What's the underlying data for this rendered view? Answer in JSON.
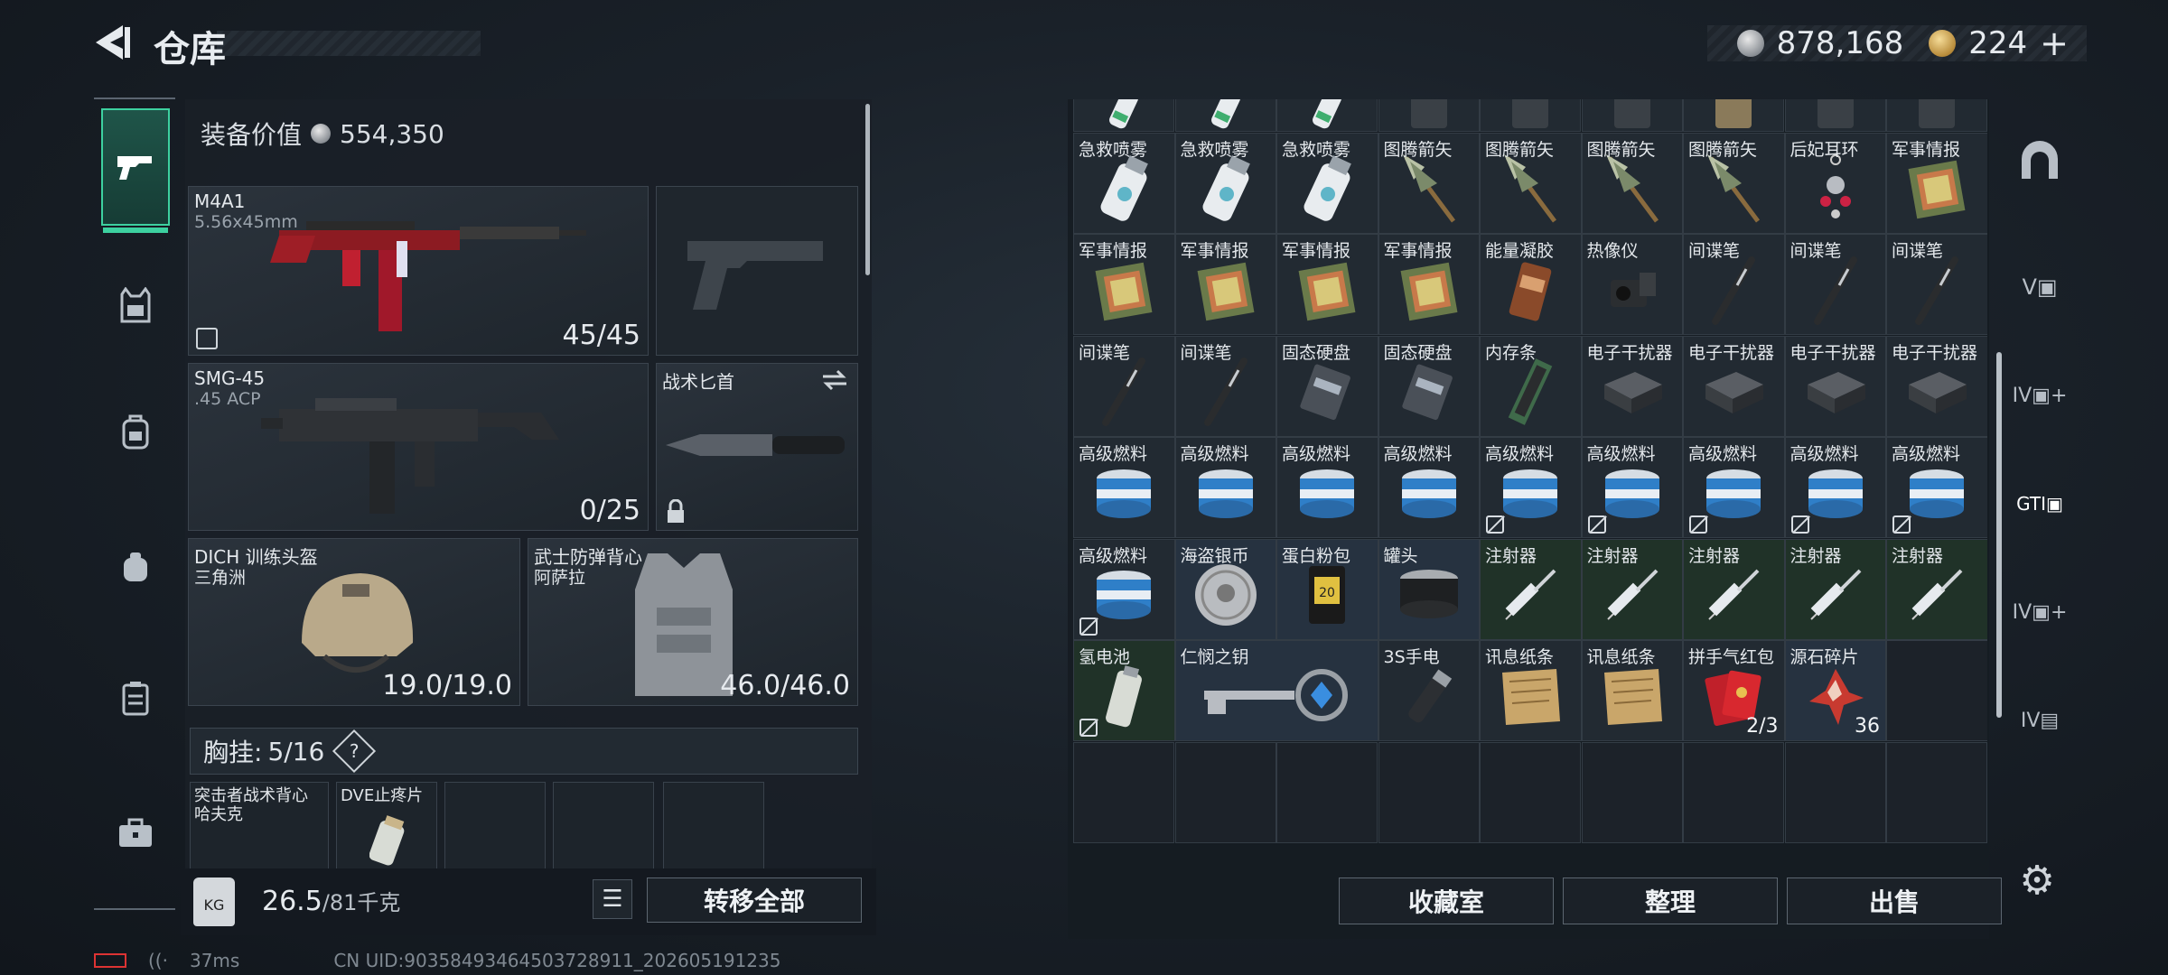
{
  "header": {
    "title": "仓库",
    "silver_amount": "878,168",
    "gold_amount": "224",
    "add_label": "+"
  },
  "equipment": {
    "value_label": "装备价值",
    "value": "554,350",
    "primary_weapon": {
      "name": "M4A1",
      "caliber": "5.56x45mm",
      "ammo": "45/45"
    },
    "secondary_weapon": {
      "name": "SMG-45",
      "caliber": ".45 ACP",
      "ammo": "0/25"
    },
    "melee": {
      "name": "战术匕首"
    },
    "helmet": {
      "name": "DICH 训练头盔",
      "sub": "三角洲",
      "durability": "19.0/19.0"
    },
    "armor": {
      "name": "武士防弹背心",
      "sub": "阿萨拉",
      "durability": "46.0/46.0"
    },
    "chest_rig": {
      "label": "胸挂:",
      "capacity": "5/16",
      "help": "?"
    },
    "chest_slots": [
      {
        "name": "突击者战术背心",
        "sub": "哈夫克"
      },
      {
        "name": "DVE止疼片",
        "sub": ""
      }
    ]
  },
  "bottom": {
    "weight_value": "26.5",
    "weight_max": "/81千克",
    "transfer_all": "转移全部"
  },
  "status": {
    "ping": "37ms",
    "uid": "CN UID:90358493464503728911_202605191235"
  },
  "storage": {
    "top_partial_row": [
      "急救喷雾",
      "急救喷雾",
      "急救喷雾",
      "",
      "",
      "",
      "",
      "",
      ""
    ],
    "rows": [
      [
        {
          "n": "急救喷雾",
          "t": "spray"
        },
        {
          "n": "急救喷雾",
          "t": "spray"
        },
        {
          "n": "急救喷雾",
          "t": "spray"
        },
        {
          "n": "图腾箭矢",
          "t": "arrow"
        },
        {
          "n": "图腾箭矢",
          "t": "arrow"
        },
        {
          "n": "图腾箭矢",
          "t": "arrow"
        },
        {
          "n": "图腾箭矢",
          "t": "arrow"
        },
        {
          "n": "后妃耳环",
          "t": "earring"
        },
        {
          "n": "军事情报",
          "t": "intel"
        }
      ],
      [
        {
          "n": "军事情报",
          "t": "intel"
        },
        {
          "n": "军事情报",
          "t": "intel"
        },
        {
          "n": "军事情报",
          "t": "intel"
        },
        {
          "n": "军事情报",
          "t": "intel"
        },
        {
          "n": "能量凝胶",
          "t": "gel"
        },
        {
          "n": "热像仪",
          "t": "thermal"
        },
        {
          "n": "间谍笔",
          "t": "pen"
        },
        {
          "n": "间谍笔",
          "t": "pen"
        },
        {
          "n": "间谍笔",
          "t": "pen"
        }
      ],
      [
        {
          "n": "间谍笔",
          "t": "pen"
        },
        {
          "n": "间谍笔",
          "t": "pen"
        },
        {
          "n": "固态硬盘",
          "t": "ssd"
        },
        {
          "n": "固态硬盘",
          "t": "ssd"
        },
        {
          "n": "内存条",
          "t": "ram"
        },
        {
          "n": "电子干扰器",
          "t": "jammer"
        },
        {
          "n": "电子干扰器",
          "t": "jammer"
        },
        {
          "n": "电子干扰器",
          "t": "jammer"
        },
        {
          "n": "电子干扰器",
          "t": "jammer"
        }
      ],
      [
        {
          "n": "高级燃料",
          "t": "fuel"
        },
        {
          "n": "高级燃料",
          "t": "fuel"
        },
        {
          "n": "高级燃料",
          "t": "fuel"
        },
        {
          "n": "高级燃料",
          "t": "fuel"
        },
        {
          "n": "高级燃料",
          "t": "fuel",
          "m": true
        },
        {
          "n": "高级燃料",
          "t": "fuel",
          "m": true
        },
        {
          "n": "高级燃料",
          "t": "fuel",
          "m": true
        },
        {
          "n": "高级燃料",
          "t": "fuel",
          "m": true
        },
        {
          "n": "高级燃料",
          "t": "fuel",
          "m": true
        }
      ],
      [
        {
          "n": "高级燃料",
          "t": "fuel",
          "m": true
        },
        {
          "n": "海盗银币",
          "t": "coin",
          "c": "blue"
        },
        {
          "n": "蛋白粉包",
          "t": "protein",
          "c": "blue"
        },
        {
          "n": "罐头",
          "t": "can",
          "c": "blue"
        },
        {
          "n": "注射器",
          "t": "syringe",
          "c": "green"
        },
        {
          "n": "注射器",
          "t": "syringe",
          "c": "green"
        },
        {
          "n": "注射器",
          "t": "syringe",
          "c": "green"
        },
        {
          "n": "注射器",
          "t": "syringe",
          "c": "green"
        },
        {
          "n": "注射器",
          "t": "syringe",
          "c": "green"
        }
      ],
      [
        {
          "n": "氢电池",
          "t": "battery",
          "c": "green",
          "m": true
        },
        {
          "n": "仁悯之钥",
          "t": "key",
          "c": "blue",
          "w": 2
        },
        {
          "n": "3S手电",
          "t": "flashlight"
        },
        {
          "n": "讯息纸条",
          "t": "note"
        },
        {
          "n": "讯息纸条",
          "t": "note"
        },
        {
          "n": "拼手气红包",
          "t": "redpacket",
          "q": "2/3"
        },
        {
          "n": "源石碎片",
          "t": "shard",
          "c": "blue",
          "q": "36"
        },
        {
          "n": "",
          "t": "empty"
        }
      ]
    ],
    "buttons": [
      "收藏室",
      "整理",
      "出售"
    ]
  },
  "colors": {
    "accent": "#3dd1a0",
    "panel": "#1a2027",
    "text": "#e4e8ec"
  }
}
